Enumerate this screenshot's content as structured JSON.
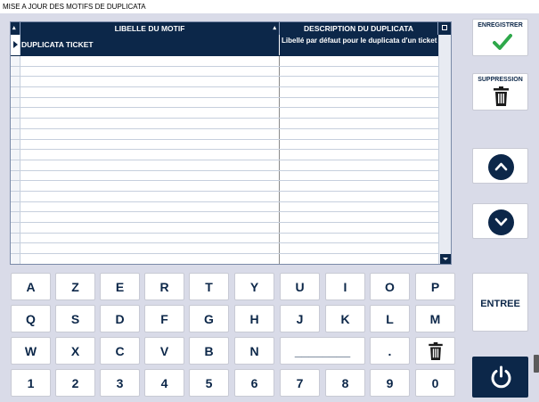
{
  "window": {
    "title": "MISE A JOUR DES MOTIFS DE DUPLICATA"
  },
  "grid": {
    "columns": [
      "LIBELLE DU MOTIF",
      "DESCRIPTION DU DUPLICATA"
    ],
    "rows": [
      {
        "motif": "DUPLICATA TICKET",
        "description": "Libellé par défaut pour le duplicata d'un ticket",
        "selected": true
      }
    ],
    "empty_row_count": 20
  },
  "actions": {
    "save_label": "ENREGISTRER",
    "delete_label": "SUPPRESSION",
    "enter_label": "ENTREE"
  },
  "keyboard": {
    "rows": [
      [
        "A",
        "Z",
        "E",
        "R",
        "T",
        "Y",
        "U",
        "I",
        "O",
        "P"
      ],
      [
        "Q",
        "S",
        "D",
        "F",
        "G",
        "H",
        "J",
        "K",
        "L",
        "M"
      ],
      [
        "W",
        "X",
        "C",
        "V",
        "B",
        "N",
        "________",
        ".",
        "trash-icon"
      ],
      [
        "1",
        "2",
        "3",
        "4",
        "5",
        "6",
        "7",
        "8",
        "9",
        "0"
      ]
    ]
  },
  "colors": {
    "navy": "#0c2749",
    "background": "#d9dbe8",
    "check_green": "#2ea84a"
  }
}
